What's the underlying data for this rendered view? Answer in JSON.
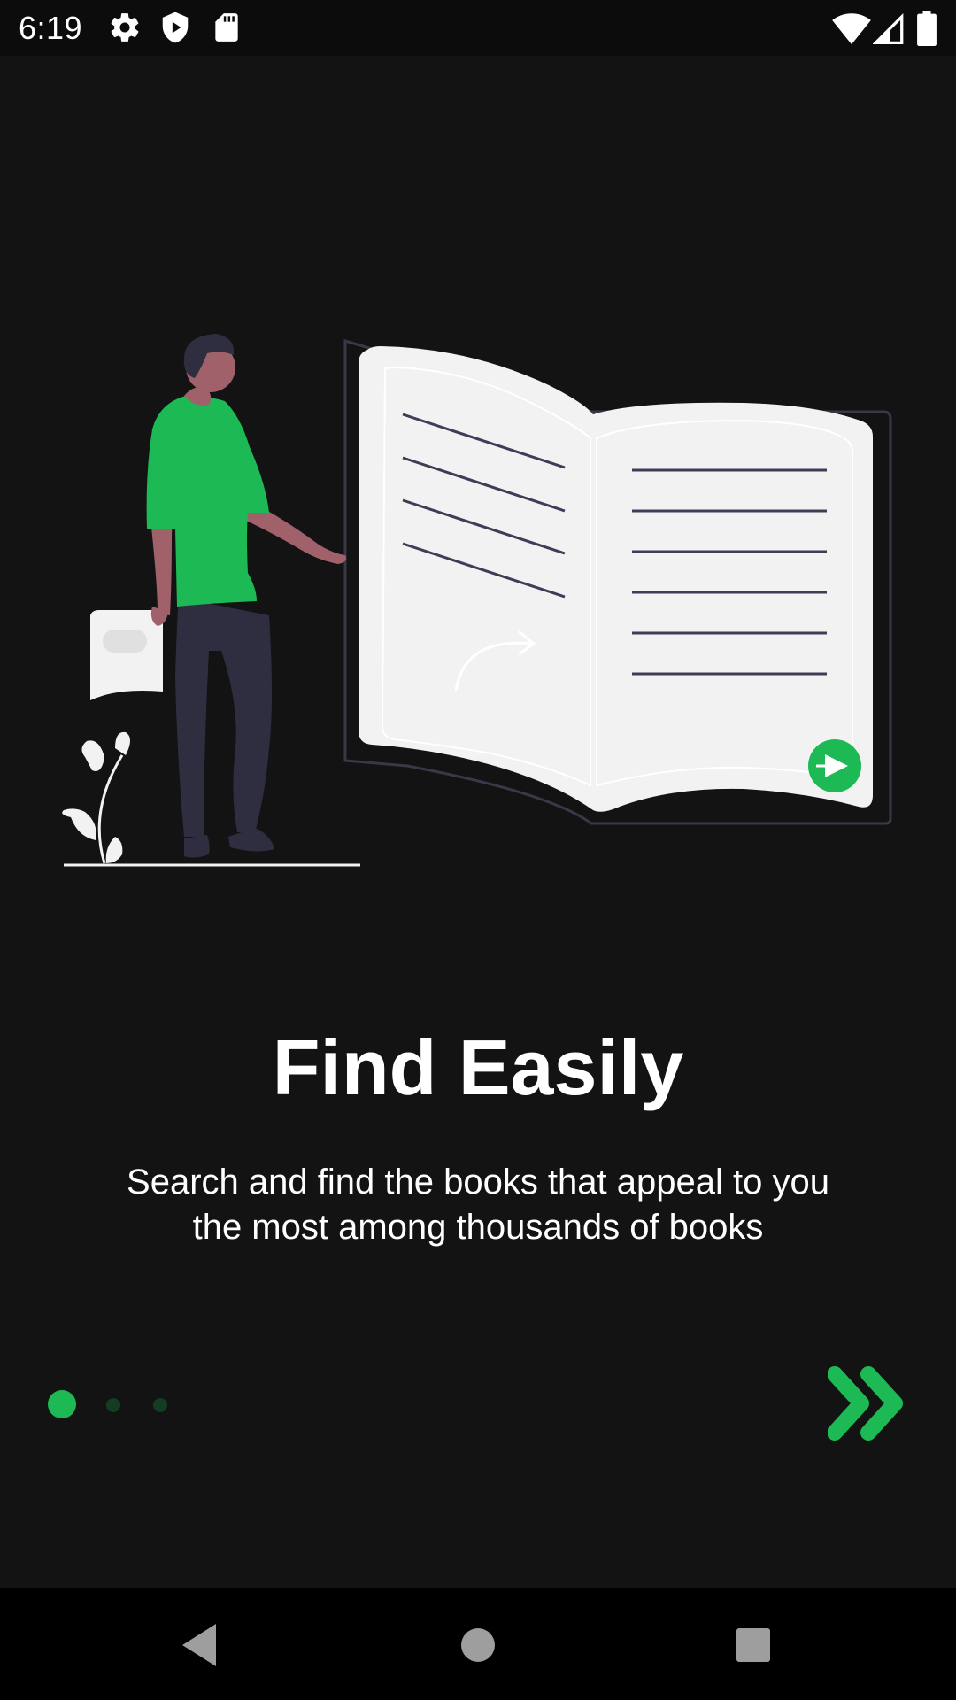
{
  "status_bar": {
    "time": "6:19",
    "left_icons": [
      "gear-icon",
      "shield-play-icon",
      "sd-card-icon"
    ],
    "right_icons": [
      "wifi-icon",
      "cell-signal-icon",
      "battery-icon"
    ]
  },
  "onboarding": {
    "title": "Find Easily",
    "description": "Search and find the books that appeal to you the most among thousands of books",
    "page_index": 0,
    "page_count": 3,
    "next_icon": "double-chevron-right-icon"
  },
  "colors": {
    "background": "#131313",
    "accent": "#1db954",
    "dot_inactive": "#133d22",
    "book_page": "#f2f2f2",
    "trousers": "#2f2e41",
    "skin": "#a0616a"
  },
  "nav_bar": {
    "buttons": [
      "back-icon",
      "home-icon",
      "recents-icon"
    ]
  }
}
